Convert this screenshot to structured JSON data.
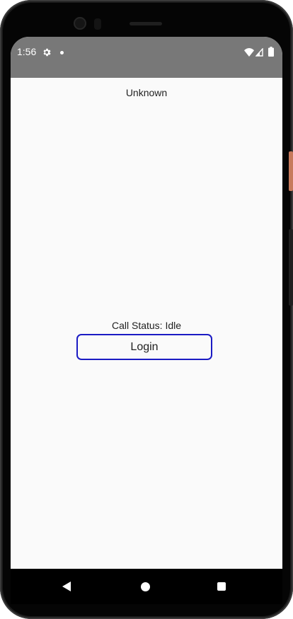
{
  "status_bar": {
    "time": "1:56",
    "icons": [
      "settings-gear-icon",
      "notification-dot-icon",
      "wifi-icon",
      "cell-signal-icon",
      "battery-icon"
    ],
    "background_color": "#787878"
  },
  "content": {
    "title": "Unknown",
    "call_status": "Call Status: Idle",
    "login_label": "Login",
    "login_border_color": "#1b1bc4"
  },
  "navigation_bar": {
    "buttons": [
      "back-icon",
      "home-icon",
      "recents-icon"
    ]
  }
}
